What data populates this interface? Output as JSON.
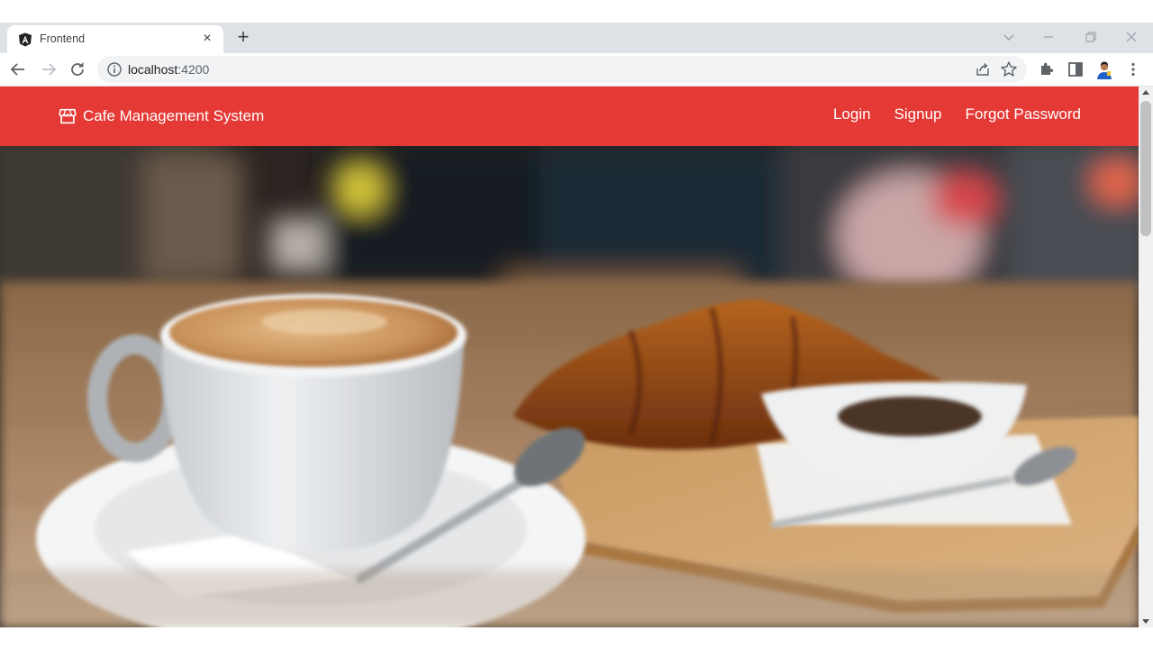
{
  "browser": {
    "tab": {
      "title": "Frontend",
      "favicon": "angular-logo-icon",
      "close_icon": "close-icon"
    },
    "new_tab_icon": "plus-icon",
    "window_controls": [
      "chevron-down-icon",
      "minimize-icon",
      "restore-icon",
      "close-icon"
    ],
    "toolbar": {
      "back_icon": "arrow-left-icon",
      "forward_icon": "arrow-right-icon",
      "reload_icon": "reload-icon",
      "address": {
        "host": "localhost",
        "port": ":4200",
        "info_icon": "info-icon"
      },
      "share_icon": "share-icon",
      "bookmark_icon": "star-icon",
      "extensions_icon": "puzzle-icon",
      "side_panel_icon": "side-panel-icon",
      "profile_icon": "avatar",
      "menu_icon": "kebab-menu-icon"
    }
  },
  "app": {
    "brand": {
      "title": "Cafe Management System",
      "icon": "storefront-icon"
    },
    "nav": {
      "login": "Login",
      "signup": "Signup",
      "forgot_password": "Forgot Password"
    },
    "hero": {
      "image": "coffee-cup-and-croissant-photo"
    },
    "colors": {
      "navbar": "#e53935",
      "nav_text": "#ffffff"
    }
  }
}
